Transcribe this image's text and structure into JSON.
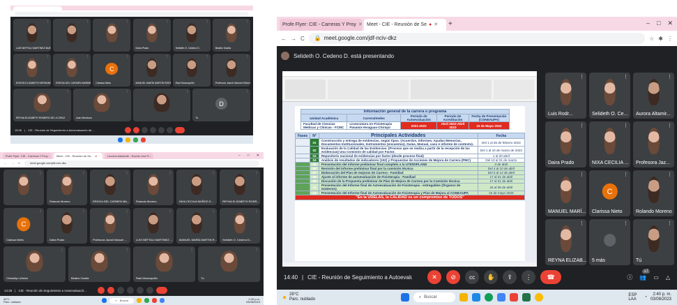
{
  "screen_a": {
    "clock": "15:26",
    "meeting_title": "CIE - Reunión de Seguimiento a Autoevaluación de...",
    "participants": [
      "LUIS NEFTALI MARTINEZ BUENO",
      "",
      "",
      "Daira Prado",
      "Selideth O. Cedeno D.",
      "Beatriz Ocaña",
      "EDSON ELIZABETH HERNANDEZ VALE...",
      "EDESIA DEL CARMEN MARIBE GARCÍA...",
      "Clarissa Nieto",
      "MANUEL MARÍA MARTIN RODRIGUEZ",
      "Raúl Moscoquiño",
      "Profesora Jaznel Manuel Olivera Do...",
      "REYNA ELIZABETH ROMERO DE LA CRUZ",
      "Juan Mendoza",
      "",
      "Tú"
    ],
    "avatar_letters": [
      "C",
      "D"
    ]
  },
  "screen_b": {
    "tabs": [
      "Profe Flyer: CIE - Carreras Y Proy...",
      "Meet - CIE - Reunión de Se...",
      "Lección Asistente - Escrito Una Fr..."
    ],
    "url": "meet.google.com/jdf-nciv-dkz",
    "clock": "14:26",
    "meeting_title": "CIE - Reunión de Seguimiento a Autoevaluació...",
    "participants": [
      "",
      "Rolando Moreno",
      "ERICKA DEL CARMEN MA...",
      "Rolando Moreno",
      "NIXA CECILIA MUÑOZ D...",
      "REYNA ELIZABETH RODR...",
      "Clarissa Nieto",
      "Daira Prado",
      "Profesora Jaznel Manuel ...",
      "LUIS NEFTALI MARTINEZ ...",
      "MANUEL MARÍA MARTIN R...",
      "Selideth O. Cedeno D...",
      "Chrisellyn Urtrela",
      "Beatriz Ocaña",
      "Raúl Moscoquiño",
      "Tú"
    ],
    "avatar_letters": [
      "C"
    ],
    "taskbar_search": "Buscar",
    "weather_temp": "28°C",
    "weather_desc": "Parc. nublado",
    "taskbar_time": "2:49 p.m.",
    "taskbar_date": "03/08/2023"
  },
  "screen_c": {
    "tabs": [
      "Profe Flyer: CIE - Carreras Y Proy",
      "Meet - CIE - Reunión de Se"
    ],
    "url": "meet.google.com/jdf-nciv-dkz",
    "presenting_banner": "Selideth O. Cedeno D. está presentando",
    "clock": "14:40",
    "meeting_title": "CIE - Reunión de Seguimiento a Autoevaluaci...",
    "participants_side": [
      {
        "name": "Luis Rodr...",
        "kind": "video"
      },
      {
        "name": "Selideth O. Ce...",
        "kind": "video"
      },
      {
        "name": "Aurora Altamir...",
        "kind": "video"
      },
      {
        "name": "Daira Prado",
        "kind": "video"
      },
      {
        "name": "NIXA CECILIA ...",
        "kind": "video"
      },
      {
        "name": "Profesora Jaz...",
        "kind": "video"
      },
      {
        "name": "MANUEL MARÍ...",
        "kind": "video"
      },
      {
        "name": "Clarissa Nieto",
        "kind": "avatar",
        "letter": "C"
      },
      {
        "name": "Rolando Moreno",
        "kind": "video"
      },
      {
        "name": "REYNA ELIZAB...",
        "kind": "video"
      },
      {
        "name": "5 más",
        "kind": "more"
      },
      {
        "name": "Tú",
        "kind": "video"
      }
    ],
    "participant_count": "17",
    "sheet": {
      "header_title": "Información general de la carrera o programa",
      "col_headers": [
        "Unidad Académica",
        "Carrera/Sedes",
        "Período de Autoevaluación",
        "Período de Acreditación",
        "Fecha de Presentación (CONEAUPA)"
      ],
      "row": [
        "Facultad de Ciencias Médicas y Clínicas - FCMC",
        "Licenciatura en Fisioterapia Panamá-Veraguas-Chiriquí",
        "2021-2022",
        "Abril 2022-Abril 2023",
        "15 de Mayo 2023"
      ],
      "table_headers": [
        "Fases",
        "N°",
        "Principales Actividades",
        "Fecha"
      ],
      "activities": [
        {
          "n": "01",
          "text": "Construcción y entrega de evidencias, según tipos. (Acuerdos, Informes, Ayudas Memorias, Documentos Institucionales, Instrumentos (encuestas), Guías, Manual, caso e informe de contexto).",
          "date": "Del 1 al 26 de febrero 2023"
        },
        {
          "n": "02",
          "text": "Evaluación de la Calidad de las Evidencias. (Proceso que se realiza a partir de la recepción de las evidencias) Una Comisión de calidad por Factor.",
          "date": "Del 1 al 10 de marzo de 2023"
        },
        {
          "n": "03",
          "text": "Repositorio nacional de evidencias por factor (desde proceso final)",
          "date": "1 al 20 abril"
        },
        {
          "n": "04",
          "text": "Análisis de resultados de indicadores (102) y Propuestas de Acciones de Mejora de Carrera (PMC)",
          "date": "Del 10 al 31 de marzo"
        },
        {
          "n": "05",
          "text": "Presentación del informe preliminar final completo a la UTE/DIPLANE",
          "date": "3 de abril"
        },
        {
          "n": "06",
          "text": "Revisión del informe preliminar final por la comisión técnica",
          "date": "Del 4 al 10 de abril"
        },
        {
          "n": "07",
          "text": "Elaboración del Plan de mejoras de Carrera - Familiad",
          "date": "Del 3 al 12 de abril"
        },
        {
          "n": "08",
          "text": "Ajuste al informe de autoevaluación de Fisioterapia - Familiad",
          "date": "17 al 21 de abril"
        },
        {
          "n": "09",
          "text": "Discusión de la Propuesta preliminar de Plan de Mejora de Carrera por la Comisión técnica",
          "date": "17 al 21 de abril"
        },
        {
          "n": "10",
          "text": "Presentación del Informe final de Autoevaluación de Fisioterapia - entregables (Órganos de Gobierno)",
          "date": "24 al 28 de abril"
        },
        {
          "n": "11",
          "text": "Presentación del Informe final de Autoevaluación de Fisioterapia y Plan de Mejora al CONEAUPA",
          "date": "15 de mayo 2023"
        }
      ],
      "footer": "\"En la UDELAS, la CALIDAD es un compromiso de TODOS\""
    },
    "taskbar_search": "Buscar",
    "weather_temp": "28°C",
    "weather_desc": "Parc. nublado",
    "taskbar_lang": "ESP LAA",
    "taskbar_time": "2:40 p. m.",
    "taskbar_date": "03/08/2023"
  },
  "colors": {
    "meet_bg": "#202124",
    "tile_bg": "#3c4043",
    "hangup_red": "#ea4335",
    "chrome_pink": "#f7d9e5",
    "avatar_orange": "#e8710a",
    "avatar_gray": "#5f6368",
    "sheet_red": "#e02b20",
    "sheet_green": "#5fa35a"
  },
  "icons": [
    "mic-off-icon",
    "camera-off-icon",
    "captions-icon",
    "hand-icon",
    "present-icon",
    "more-icon",
    "hangup-icon",
    "info-icon",
    "people-icon",
    "chat-icon",
    "activities-icon",
    "windows-start-icon",
    "search-icon"
  ]
}
